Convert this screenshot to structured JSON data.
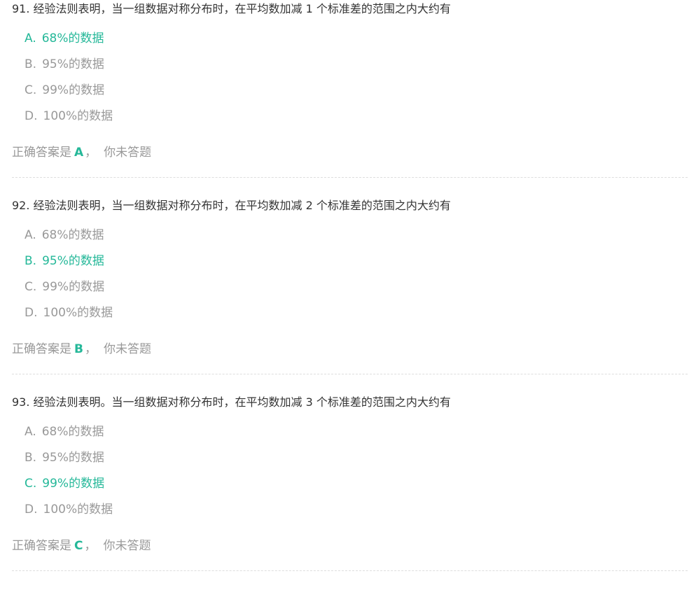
{
  "accent_color": "#25b899",
  "muted_color": "#999999",
  "answer_prefix": "正确答案是",
  "answer_suffix": "，",
  "status_text": "你未答题",
  "questions": [
    {
      "title": "91.  经验法则表明，当一组数据对称分布时，在平均数加减 1 个标准差的范围之内大约有",
      "correct": "A",
      "options": [
        {
          "key": "A.",
          "text": "68%的数据"
        },
        {
          "key": "B.",
          "text": "95%的数据"
        },
        {
          "key": "C.",
          "text": "99%的数据"
        },
        {
          "key": "D.",
          "text": "100%的数据"
        }
      ]
    },
    {
      "title": "92.  经验法则表明，当一组数据对称分布时，在平均数加减 2 个标准差的范围之内大约有",
      "correct": "B",
      "options": [
        {
          "key": "A.",
          "text": "68%的数据"
        },
        {
          "key": "B.",
          "text": "95%的数据"
        },
        {
          "key": "C.",
          "text": "99%的数据"
        },
        {
          "key": "D.",
          "text": "100%的数据"
        }
      ]
    },
    {
      "title": "93.  经验法则表明。当一组数据对称分布时，在平均数加减 3 个标准差的范围之内大约有",
      "correct": "C",
      "options": [
        {
          "key": "A.",
          "text": "68%的数据"
        },
        {
          "key": "B.",
          "text": "95%的数据"
        },
        {
          "key": "C.",
          "text": "99%的数据"
        },
        {
          "key": "D.",
          "text": "100%的数据"
        }
      ]
    }
  ]
}
